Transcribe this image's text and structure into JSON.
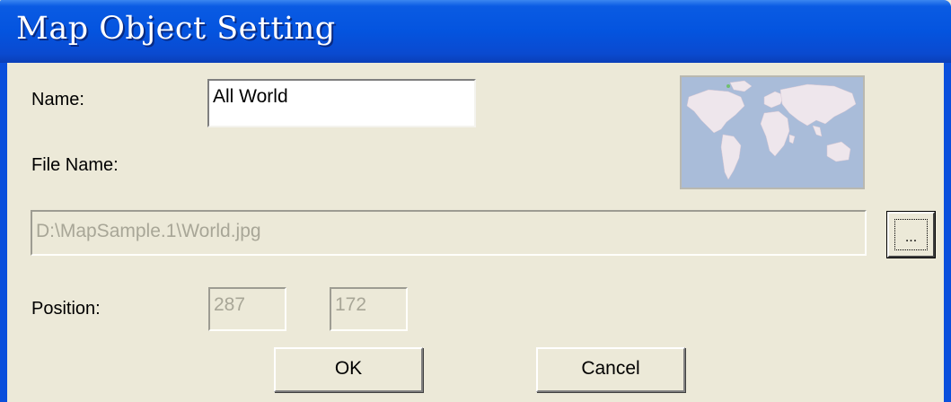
{
  "window": {
    "title": "Map Object Setting"
  },
  "fields": {
    "name_label": "Name:",
    "name_value": "All World",
    "file_name_label": "File Name:",
    "file_path_value": "D:\\MapSample.1\\World.jpg",
    "position_label": "Position:",
    "position_x": "287",
    "position_y": "172"
  },
  "buttons": {
    "browse": "...",
    "ok": "OK",
    "cancel": "Cancel"
  },
  "preview": {
    "icon": "world-map-thumbnail"
  },
  "colors": {
    "title_bar": "#0454df",
    "dialog_bg": "#ece9d8",
    "map_ocean": "#a9bcd9",
    "map_land": "#eee6ec"
  }
}
